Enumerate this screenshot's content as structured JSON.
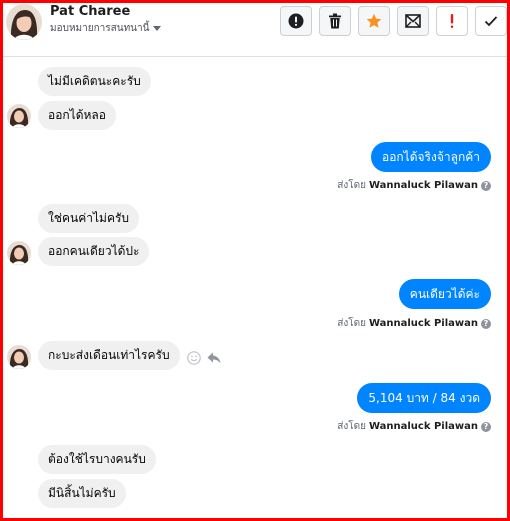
{
  "header": {
    "contact_name": "Pat Charee",
    "assign_label": "มอบหมายการสนทนานี้",
    "actions": [
      {
        "name": "mark-spam-button",
        "icon": "exclamation-circle-icon"
      },
      {
        "name": "delete-button",
        "icon": "trash-icon"
      },
      {
        "name": "star-button",
        "icon": "star-icon"
      },
      {
        "name": "mark-unread-button",
        "icon": "envelope-icon"
      },
      {
        "name": "follow-up-button",
        "icon": "red-exclamation-icon"
      },
      {
        "name": "mark-done-button",
        "icon": "checkmark-icon"
      }
    ],
    "colors": {
      "star": "#f7931e",
      "follow_up": "#e02020"
    }
  },
  "messages": {
    "in_1": "ไม่มีเคดิตนะคะรับ",
    "in_2": "ออกได้หลอ",
    "out_1": "ออกได้จริงจ้าลูกค้า",
    "in_3": "ใช่คนค่าไม่ครับ",
    "in_4": "ออกคนเดียวได้ปะ",
    "out_2": "คนเดียวได้ค่ะ",
    "in_5": "กะบะส่งเดือนเท่าไรครับ",
    "out_3": "5,104 บาท / 84 งวด",
    "in_6": "ต้องใช้ไรบางคนรับ",
    "in_7": "มีนิสิ้นไม่ครับ"
  },
  "sent_by": {
    "prefix": "ส่งโดย",
    "agent": "Wannaluck Pilawan",
    "help_glyph": "?"
  },
  "colors": {
    "outgoing_bubble": "#0084ff",
    "incoming_bubble": "#f1f0f0",
    "frame": "#ff0000"
  }
}
